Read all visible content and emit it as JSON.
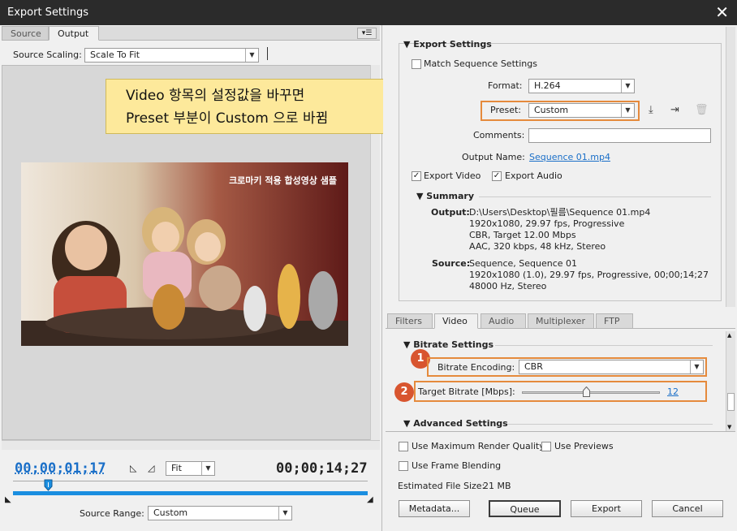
{
  "window": {
    "title": "Export Settings",
    "close": "✕"
  },
  "left": {
    "tabs": [
      "Source",
      "Output"
    ],
    "source_scaling_label": "Source Scaling:",
    "source_scaling_value": "Scale To Fit",
    "video_caption": "크로마키 적용 합성영상 샘플",
    "current_time": "00;00;01;17",
    "fit_value": "Fit",
    "duration": "00;00;14;27",
    "source_range_label": "Source Range:",
    "source_range_value": "Custom",
    "playhead_fraction": 0.1
  },
  "callout": {
    "line1": "Video 항목의 설정값을 바꾸면",
    "line2": "Preset  부분이 Custom 으로 바뀜"
  },
  "export_settings": {
    "header": "Export Settings",
    "match_sequence": "Match Sequence Settings",
    "format_label": "Format:",
    "format_value": "H.264",
    "preset_label": "Preset:",
    "preset_value": "Custom",
    "comments_label": "Comments:",
    "comments_value": "",
    "output_name_label": "Output Name:",
    "output_name_value": "Sequence 01.mp4",
    "export_video": "Export Video",
    "export_audio": "Export Audio",
    "summary_header": "Summary",
    "output_label": "Output:",
    "output_lines": [
      "D:\\Users\\Desktop\\필름\\Sequence 01.mp4",
      "1920x1080, 29.97 fps, Progressive",
      "CBR, Target 12.00 Mbps",
      "AAC, 320 kbps, 48 kHz, Stereo"
    ],
    "source_label": "Source:",
    "source_lines": [
      "Sequence, Sequence 01",
      "1920x1080 (1.0), 29.97 fps, Progressive, 00;00;14;27",
      "48000 Hz, Stereo"
    ]
  },
  "bottom_tabs": [
    "Filters",
    "Video",
    "Audio",
    "Multiplexer",
    "FTP"
  ],
  "bitrate": {
    "header": "Bitrate Settings",
    "encoding_label": "Bitrate Encoding:",
    "encoding_value": "CBR",
    "target_label": "Target Bitrate [Mbps]:",
    "target_value": "12",
    "slider_fraction": 0.47,
    "advanced_header": "Advanced Settings",
    "badge1": "1",
    "badge2": "2"
  },
  "options": {
    "max_render": "Use Maximum Render Quality",
    "use_previews": "Use Previews",
    "frame_blending": "Use Frame Blending",
    "file_size_label": "Estimated File Size:",
    "file_size_value": "21 MB"
  },
  "buttons": {
    "metadata": "Metadata...",
    "queue": "Queue",
    "export": "Export",
    "cancel": "Cancel"
  },
  "colors": {
    "accent": "#1a6fc8",
    "orange": "#e58a3c",
    "badge": "#d8552f",
    "callout": "#fde99b"
  }
}
